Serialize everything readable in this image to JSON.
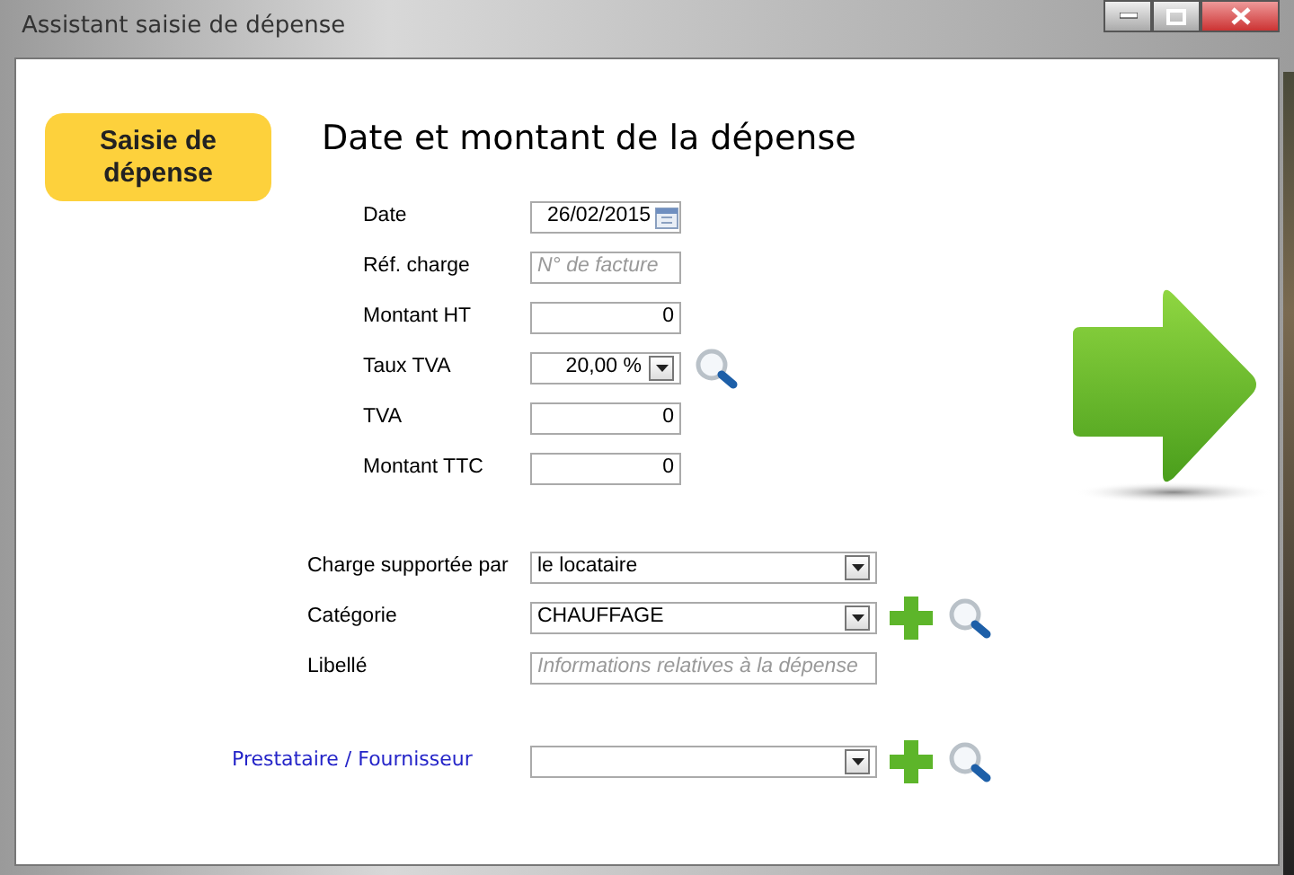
{
  "window": {
    "title": "Assistant saisie de dépense"
  },
  "step_badge": "Saisie de dépense",
  "heading": "Date et montant de la dépense",
  "amount_fields": [
    {
      "label": "Date",
      "kind": "date",
      "value": "26/02/2015"
    },
    {
      "label": "Réf. charge",
      "kind": "text",
      "placeholder": "N° de facture"
    },
    {
      "label": "Montant HT",
      "kind": "number",
      "value": "0"
    },
    {
      "label": "Taux TVA",
      "kind": "combo",
      "value": "20,00 %",
      "search": true
    },
    {
      "label": "TVA",
      "kind": "number",
      "value": "0"
    },
    {
      "label": "Montant TTC",
      "kind": "number",
      "value": "0"
    }
  ],
  "detail_fields": [
    {
      "label": "Charge supportée par",
      "kind": "combo",
      "value": "le locataire"
    },
    {
      "label": "Catégorie",
      "kind": "combo",
      "value": "CHAUFFAGE",
      "add": true,
      "search": true
    },
    {
      "label": "Libellé",
      "kind": "text",
      "placeholder": "Informations relatives à la dépense"
    },
    {
      "label": "Prestataire / Fournisseur",
      "kind": "combo",
      "link": true,
      "add": true,
      "search": true
    }
  ]
}
